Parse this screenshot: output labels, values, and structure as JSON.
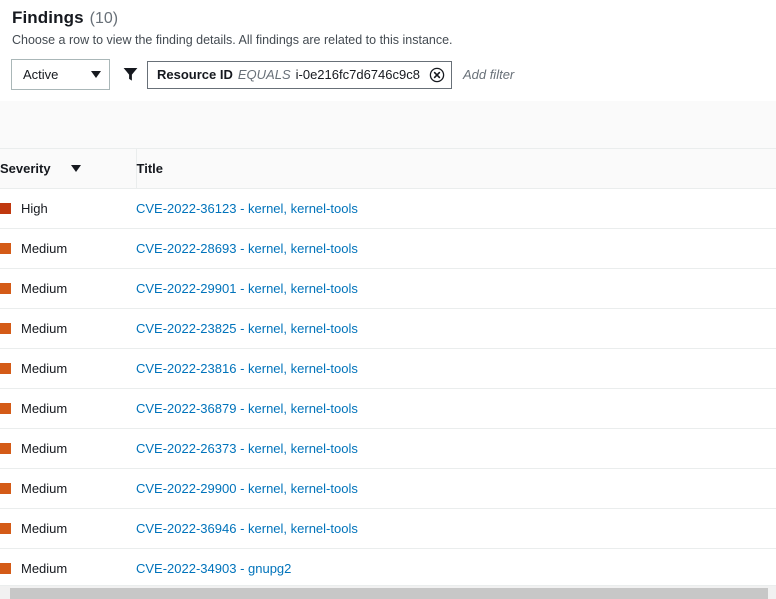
{
  "panel": {
    "title": "Findings",
    "count": "(10)",
    "description": "Choose a row to view the finding details. All findings are related to this instance."
  },
  "filter_bar": {
    "status_select": {
      "value": "Active",
      "caret_icon": "chevron-down-icon"
    },
    "funnel_icon": "filter-funnel-icon",
    "token": {
      "key": "Resource ID",
      "operator": "EQUALS",
      "value": "i-0e216fc7d6746c9c8",
      "clear_icon": "close-circle-icon"
    },
    "add_filter_placeholder": "Add filter"
  },
  "table": {
    "columns": [
      {
        "label": "Severity",
        "sort_icon": "sort-descending-icon"
      },
      {
        "label": "Title"
      }
    ],
    "rows": [
      {
        "severity": "High",
        "severity_color": "#c0380e",
        "title": "CVE-2022-36123 - kernel, kernel-tools"
      },
      {
        "severity": "Medium",
        "severity_color": "#d45b17",
        "title": "CVE-2022-28693 - kernel, kernel-tools"
      },
      {
        "severity": "Medium",
        "severity_color": "#d45b17",
        "title": "CVE-2022-29901 - kernel, kernel-tools"
      },
      {
        "severity": "Medium",
        "severity_color": "#d45b17",
        "title": "CVE-2022-23825 - kernel, kernel-tools"
      },
      {
        "severity": "Medium",
        "severity_color": "#d45b17",
        "title": "CVE-2022-23816 - kernel, kernel-tools"
      },
      {
        "severity": "Medium",
        "severity_color": "#d45b17",
        "title": "CVE-2022-36879 - kernel, kernel-tools"
      },
      {
        "severity": "Medium",
        "severity_color": "#d45b17",
        "title": "CVE-2022-26373 - kernel, kernel-tools"
      },
      {
        "severity": "Medium",
        "severity_color": "#d45b17",
        "title": "CVE-2022-29900 - kernel, kernel-tools"
      },
      {
        "severity": "Medium",
        "severity_color": "#d45b17",
        "title": "CVE-2022-36946 - kernel, kernel-tools"
      },
      {
        "severity": "Medium",
        "severity_color": "#d45b17",
        "title": "CVE-2022-34903 - gnupg2"
      }
    ]
  },
  "scrollbar": {
    "orientation": "horizontal"
  },
  "colors": {
    "link": "#0073bb",
    "severity_high": "#c0380e",
    "severity_medium": "#d45b17",
    "border": "#eaeded",
    "header_bg": "#fafafa"
  }
}
